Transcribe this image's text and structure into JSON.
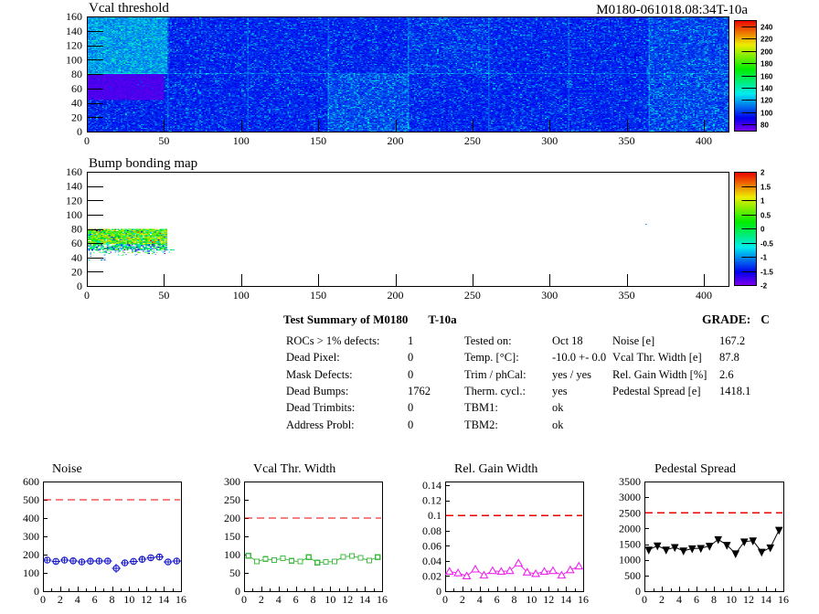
{
  "page": {
    "background": "#ffffff"
  },
  "summary": {
    "title": "Test Summary of M0180",
    "module_type": "T-10a",
    "grade_label": "GRADE:",
    "grade_value": "C",
    "left_items": [
      {
        "label": "ROCs > 1% defects:",
        "value": "1"
      },
      {
        "label": "Dead Pixel:",
        "value": "0"
      },
      {
        "label": "Mask Defects:",
        "value": "0"
      },
      {
        "label": "Dead Bumps:",
        "value": "1762"
      },
      {
        "label": "Dead Trimbits:",
        "value": "0"
      },
      {
        "label": "Address Probl:",
        "value": "0"
      }
    ],
    "middle_items": [
      {
        "label": "Tested on:",
        "value": "Oct 18"
      },
      {
        "label": "Temp. [°C]:",
        "value": "-10.0 +- 0.0"
      },
      {
        "label": "Trim / phCal:",
        "value": "yes / yes"
      },
      {
        "label": "Therm. cycl.:",
        "value": "yes"
      },
      {
        "label": "TBM1:",
        "value": "ok"
      },
      {
        "label": "TBM2:",
        "value": "ok"
      }
    ],
    "right_items": [
      {
        "label": "Noise [e]",
        "value": "167.2"
      },
      {
        "label": "Vcal Thr. Width [e]",
        "value": "87.8"
      },
      {
        "label": "Rel. Gain Width [%]",
        "value": "2.6"
      },
      {
        "label": "Pedestal Spread [e]",
        "value": "1418.1"
      }
    ]
  },
  "chart_data": [
    {
      "type": "heatmap",
      "title": "Vcal threshold",
      "header_label": "M0180-061018.08:34T-10a",
      "x_range": [
        0,
        416
      ],
      "y_range": [
        0,
        160
      ],
      "x_ticks": [
        0,
        50,
        100,
        150,
        200,
        250,
        300,
        350,
        400
      ],
      "y_ticks": [
        0,
        20,
        40,
        60,
        80,
        100,
        120,
        140,
        160
      ],
      "colorbar": {
        "min": 70,
        "max": 250,
        "ticks": [
          80,
          100,
          120,
          140,
          160,
          180,
          200,
          220,
          240
        ]
      },
      "regions": [
        {
          "x": [
            0,
            416
          ],
          "y": [
            0,
            160
          ],
          "base": 95,
          "noise": 6,
          "speckle": 0.14
        },
        {
          "x": [
            156,
            209
          ],
          "y": [
            0,
            80
          ],
          "base": 100,
          "noise": 7,
          "speckle": 0.24
        },
        {
          "x": [
            364,
            416
          ],
          "y": [
            0,
            80
          ],
          "base": 99,
          "noise": 7,
          "speckle": 0.24
        },
        {
          "x": [
            364,
            416
          ],
          "y": [
            80,
            160
          ],
          "base": 99,
          "noise": 7,
          "speckle": 0.2
        },
        {
          "x": [
            208,
            262
          ],
          "y": [
            80,
            160
          ],
          "base": 97,
          "noise": 7,
          "speckle": 0.18
        },
        {
          "x": [
            0,
            52
          ],
          "y": [
            80,
            160
          ],
          "base": 114,
          "noise": 9,
          "speckle": 0.2
        },
        {
          "x": [
            0,
            50
          ],
          "y": [
            44,
            80
          ],
          "base": 77,
          "noise": 3,
          "speckle": 0.02
        }
      ],
      "specks": [
        {
          "x": 105,
          "y": 8,
          "v": 248
        }
      ]
    },
    {
      "type": "heatmap",
      "title": "Bump bonding map",
      "x_range": [
        0,
        416
      ],
      "y_range": [
        0,
        160
      ],
      "x_ticks": [
        0,
        50,
        100,
        150,
        200,
        250,
        300,
        350,
        400
      ],
      "y_ticks": [
        0,
        20,
        40,
        60,
        80,
        100,
        120,
        140,
        160
      ],
      "colorbar": {
        "min": -2,
        "max": 2,
        "ticks": [
          2,
          1.5,
          1,
          0.5,
          0,
          -0.5,
          -1,
          -1.5,
          -2
        ]
      },
      "cluster": {
        "x": [
          0,
          52
        ],
        "y_top": 80,
        "y_dense": 58,
        "y_mid": 50,
        "y_low": 46,
        "y_tail": 42
      },
      "specks": [
        {
          "x": 362,
          "y": 86,
          "v": -1
        }
      ]
    },
    {
      "type": "line",
      "title": "Noise",
      "style": "errorbars",
      "marker": "circle",
      "color": "#1a1acc",
      "threshold": 500,
      "threshold_color": "#ee0000",
      "ylim": [
        0,
        600
      ],
      "y_ticks": [
        0,
        100,
        200,
        300,
        400,
        500,
        600
      ],
      "xlim": [
        0,
        16
      ],
      "x_ticks": [
        0,
        2,
        4,
        6,
        8,
        10,
        12,
        14,
        16
      ],
      "x": [
        0.5,
        1.5,
        2.5,
        3.5,
        4.5,
        5.5,
        6.5,
        7.5,
        8.5,
        9.5,
        10.5,
        11.5,
        12.5,
        13.5,
        14.5,
        15.5
      ],
      "values": [
        170,
        163,
        170,
        166,
        160,
        164,
        165,
        165,
        125,
        155,
        163,
        174,
        183,
        187,
        160,
        165
      ],
      "errors": [
        13,
        13,
        13,
        13,
        13,
        13,
        13,
        13,
        26,
        13,
        13,
        13,
        13,
        16,
        13,
        13
      ]
    },
    {
      "type": "line",
      "title": "Vcal Thr. Width",
      "style": "line",
      "marker": "square",
      "color": "#44bb44",
      "threshold": 200,
      "threshold_color": "#ee0000",
      "ylim": [
        0,
        300
      ],
      "y_ticks": [
        0,
        50,
        100,
        150,
        200,
        250,
        300
      ],
      "xlim": [
        0,
        16
      ],
      "x_ticks": [
        0,
        2,
        4,
        6,
        8,
        10,
        12,
        14,
        16
      ],
      "x": [
        0.5,
        1.5,
        2.5,
        3.5,
        4.5,
        5.5,
        6.5,
        7.5,
        8.5,
        9.5,
        10.5,
        11.5,
        12.5,
        13.5,
        14.5,
        15.5
      ],
      "values": [
        97,
        81,
        88,
        85,
        90,
        83,
        81,
        93,
        78,
        80,
        81,
        94,
        96,
        91,
        84,
        93
      ]
    },
    {
      "type": "line",
      "title": "Rel. Gain Width",
      "style": "line",
      "marker": "triangle-up",
      "color": "#ee22ee",
      "threshold": 0.1,
      "threshold_color": "#ee0000",
      "ylim": [
        0,
        0.145
      ],
      "y_ticks": [
        0,
        0.02,
        0.04,
        0.06,
        0.08,
        0.1,
        0.12,
        0.14
      ],
      "xlim": [
        0,
        16
      ],
      "x_ticks": [
        0,
        2,
        4,
        6,
        8,
        10,
        12,
        14,
        16
      ],
      "x": [
        0.5,
        1.5,
        2.5,
        3.5,
        4.5,
        5.5,
        6.5,
        7.5,
        8.5,
        9.5,
        10.5,
        11.5,
        12.5,
        13.5,
        14.5,
        15.5
      ],
      "values": [
        0.026,
        0.024,
        0.02,
        0.029,
        0.021,
        0.027,
        0.026,
        0.027,
        0.037,
        0.025,
        0.023,
        0.026,
        0.027,
        0.021,
        0.028,
        0.033
      ]
    },
    {
      "type": "line",
      "title": "Pedestal Spread",
      "style": "line",
      "marker": "triangle-down-filled",
      "color": "#000000",
      "threshold": 2500,
      "threshold_color": "#ee0000",
      "ylim": [
        0,
        3500
      ],
      "y_ticks": [
        0,
        500,
        1000,
        1500,
        2000,
        2500,
        3000,
        3500
      ],
      "xlim": [
        0,
        16
      ],
      "x_ticks": [
        0,
        2,
        4,
        6,
        8,
        10,
        12,
        14,
        16
      ],
      "x": [
        0.5,
        1.5,
        2.5,
        3.5,
        4.5,
        5.5,
        6.5,
        7.5,
        8.5,
        9.5,
        10.5,
        11.5,
        12.5,
        13.5,
        14.5,
        15.5
      ],
      "values": [
        1320,
        1450,
        1320,
        1400,
        1290,
        1360,
        1370,
        1440,
        1650,
        1470,
        1200,
        1580,
        1610,
        1250,
        1390,
        1950
      ]
    }
  ]
}
